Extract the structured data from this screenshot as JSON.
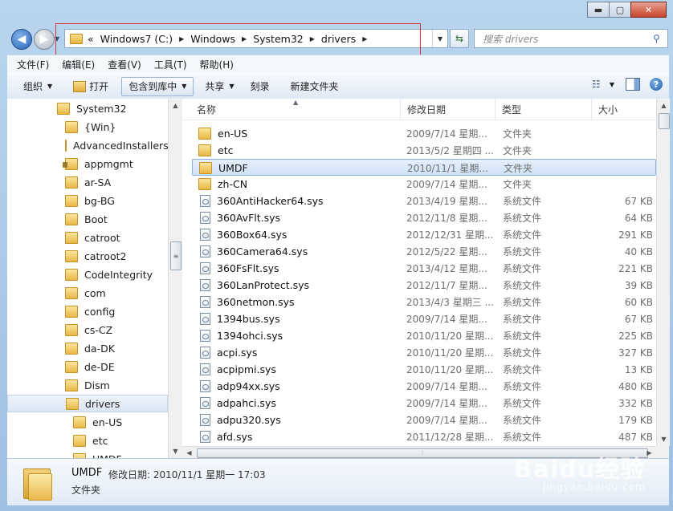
{
  "window": {
    "caption": {
      "minimize": "▬",
      "maximize": "▢",
      "close": "✕"
    }
  },
  "nav": {
    "back_glyph": "◀",
    "forward_glyph": "▶",
    "breadcrumb": [
      "Windows7 (C:)",
      "Windows",
      "System32",
      "drivers"
    ],
    "breadcrumb_prefix": "«",
    "search_placeholder": "搜索 drivers"
  },
  "menu": [
    "文件(F)",
    "编辑(E)",
    "查看(V)",
    "工具(T)",
    "帮助(H)"
  ],
  "toolbar": {
    "organize": "组织",
    "open": "打开",
    "include_library": "包含到库中",
    "share": "共享",
    "burn": "刻录",
    "new_folder": "新建文件夹"
  },
  "tree": {
    "root": "System32",
    "items": [
      "{Win}",
      "AdvancedInstallers",
      "appmgmt",
      "ar-SA",
      "bg-BG",
      "Boot",
      "catroot",
      "catroot2",
      "CodeIntegrity",
      "com",
      "config",
      "cs-CZ",
      "da-DK",
      "de-DE",
      "Dism",
      "drivers"
    ],
    "sub_items": [
      "en-US",
      "etc",
      "UMDF"
    ],
    "selected": "drivers",
    "locked": "appmgmt"
  },
  "columns": {
    "name": "名称",
    "date": "修改日期",
    "type": "类型",
    "size": "大小"
  },
  "files": [
    {
      "name": "en-US",
      "date": "2009/7/14 星期...",
      "type": "文件夹",
      "size": "",
      "folder": true
    },
    {
      "name": "etc",
      "date": "2013/5/2 星期四 ...",
      "type": "文件夹",
      "size": "",
      "folder": true
    },
    {
      "name": "UMDF",
      "date": "2010/11/1 星期...",
      "type": "文件夹",
      "size": "",
      "folder": true,
      "selected": true
    },
    {
      "name": "zh-CN",
      "date": "2009/7/14 星期...",
      "type": "文件夹",
      "size": "",
      "folder": true
    },
    {
      "name": "360AntiHacker64.sys",
      "date": "2013/4/19 星期...",
      "type": "系统文件",
      "size": "67 KB"
    },
    {
      "name": "360AvFlt.sys",
      "date": "2012/11/8 星期...",
      "type": "系统文件",
      "size": "64 KB"
    },
    {
      "name": "360Box64.sys",
      "date": "2012/12/31 星期...",
      "type": "系统文件",
      "size": "291 KB"
    },
    {
      "name": "360Camera64.sys",
      "date": "2012/5/22 星期...",
      "type": "系统文件",
      "size": "40 KB"
    },
    {
      "name": "360FsFlt.sys",
      "date": "2013/4/12 星期...",
      "type": "系统文件",
      "size": "221 KB"
    },
    {
      "name": "360LanProtect.sys",
      "date": "2012/11/7 星期...",
      "type": "系统文件",
      "size": "39 KB"
    },
    {
      "name": "360netmon.sys",
      "date": "2013/4/3 星期三 ...",
      "type": "系统文件",
      "size": "60 KB"
    },
    {
      "name": "1394bus.sys",
      "date": "2009/7/14 星期...",
      "type": "系统文件",
      "size": "67 KB"
    },
    {
      "name": "1394ohci.sys",
      "date": "2010/11/20 星期...",
      "type": "系统文件",
      "size": "225 KB"
    },
    {
      "name": "acpi.sys",
      "date": "2010/11/20 星期...",
      "type": "系统文件",
      "size": "327 KB"
    },
    {
      "name": "acpipmi.sys",
      "date": "2010/11/20 星期...",
      "type": "系统文件",
      "size": "13 KB"
    },
    {
      "name": "adp94xx.sys",
      "date": "2009/7/14 星期...",
      "type": "系统文件",
      "size": "480 KB"
    },
    {
      "name": "adpahci.sys",
      "date": "2009/7/14 星期...",
      "type": "系统文件",
      "size": "332 KB"
    },
    {
      "name": "adpu320.sys",
      "date": "2009/7/14 星期...",
      "type": "系统文件",
      "size": "179 KB"
    },
    {
      "name": "afd.sys",
      "date": "2011/12/28 星期...",
      "type": "系统文件",
      "size": "487 KB"
    }
  ],
  "details": {
    "name": "UMDF",
    "modified": "修改日期: 2010/11/1 星期一 17:03",
    "type": "文件夹"
  },
  "watermark": {
    "text": "Baidu经验",
    "sub": "jingyan.baidu.com"
  }
}
